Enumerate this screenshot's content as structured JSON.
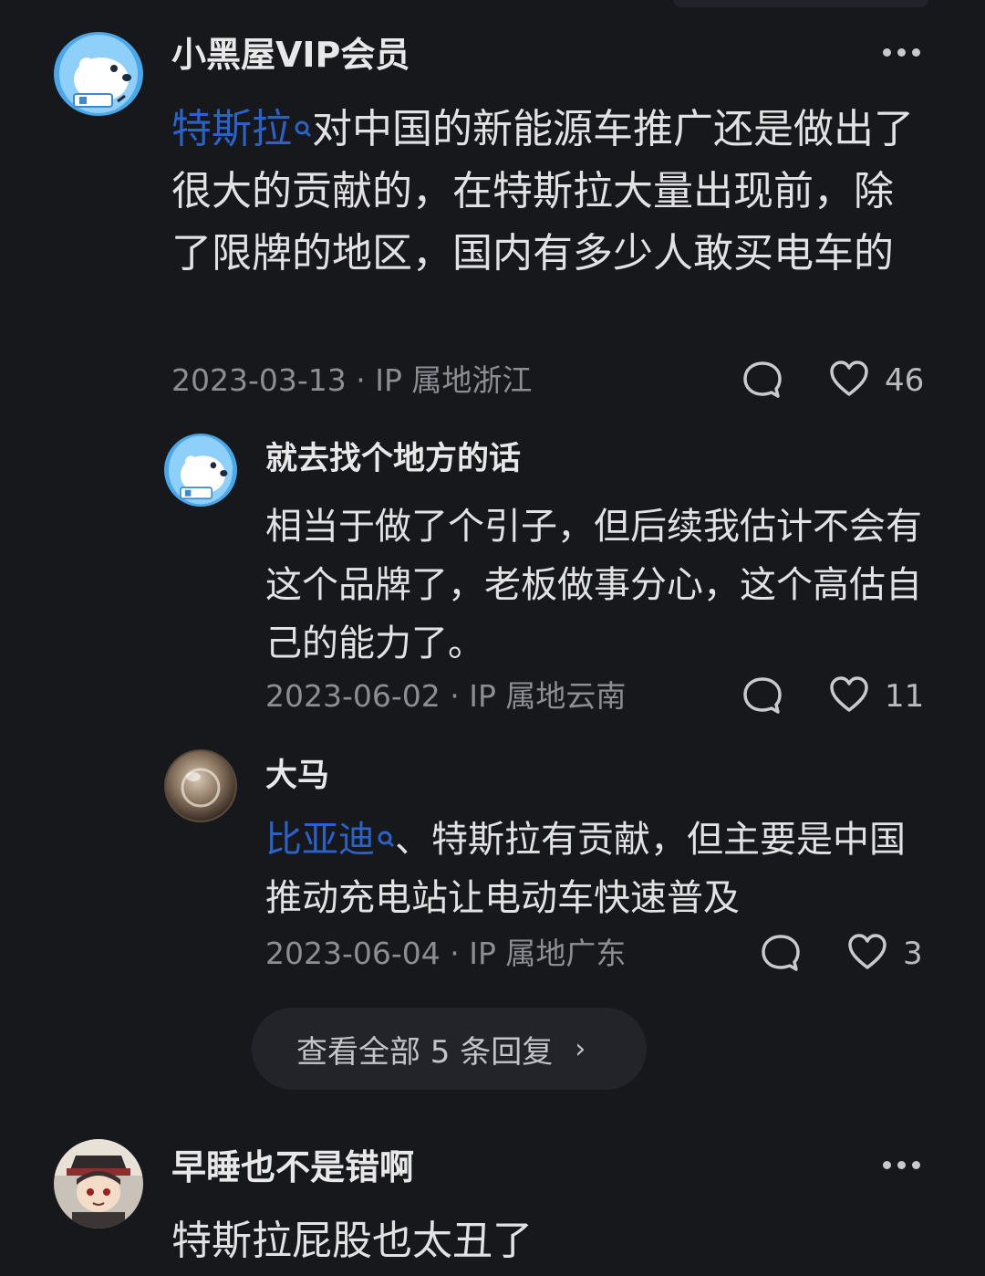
{
  "comments": [
    {
      "username": "小黑屋VIP会员",
      "topic": "特斯拉",
      "text_after_topic": "对中国的新能源车推广还是做出了很大的贡献的，在特斯拉大量出现前，除了限牌的地区，国内有多少人敢买电车的",
      "meta": "2023-03-13 · IP 属地浙江",
      "likes": "46",
      "avatar_icon": "polar-bear-avatar"
    },
    {
      "username": "早睡也不是错啊",
      "text": "特斯拉屁股也太丑了",
      "avatar_icon": "anime-character-avatar"
    }
  ],
  "replies": [
    {
      "username": "就去找个地方的话",
      "text": "相当于做了个引子，但后续我估计不会有这个品牌了，老板做事分心，这个高估自己的能力了。",
      "meta": "2023-06-02 · IP 属地云南",
      "likes": "11",
      "avatar_icon": "polar-bear-avatar"
    },
    {
      "username": "大马",
      "topic": "比亚迪",
      "text_after_topic": "、特斯拉有贡献，但主要是中国推动充电站让电动车快速普及",
      "meta": "2023-06-04 · IP 属地广东",
      "likes": "3",
      "avatar_icon": "crystal-ball-avatar"
    }
  ],
  "view_all": {
    "label": "查看全部 5 条回复",
    "chevron": "›"
  },
  "colors": {
    "background": "#17181c",
    "link_blue": "#2b62c9",
    "meta_gray": "#8d8e93",
    "pill_bg": "#232429"
  }
}
